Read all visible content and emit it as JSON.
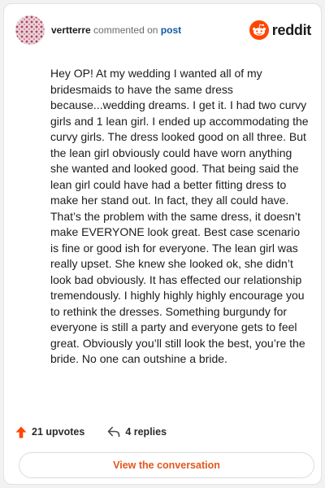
{
  "header": {
    "username": "vertterre",
    "action": "commented on",
    "target": "post",
    "logo_text": "reddit"
  },
  "comment": {
    "body": "Hey OP! At my wedding I wanted all of my bridesmaids to have the same dress because...wedding dreams. I get it. I had two curvy girls and 1 lean girl. I ended up accommodating the curvy girls. The dress looked good on all three. But the lean girl obviously could have worn anything she wanted and looked good. That being said the lean girl could have had a better fitting dress to make her stand out. In fact, they all could have. That’s the problem with the same dress, it doesn’t make EVERYONE look great. Best case scenario is fine or good ish for everyone. The lean girl was really upset. She knew she looked ok, she didn’t look bad obviously. It has effected our relationship tremendously. I highly highly highly encourage you to rethink the dresses. Something burgundy for everyone is still a party and everyone gets to feel great. Obviously you’ll still look the best, you’re the bride. No one can outshine a bride."
  },
  "footer": {
    "upvotes_label": "21 upvotes",
    "replies_label": "4 replies",
    "view_button_label": "View the conversation"
  },
  "icons": {
    "upvote": "upvote-arrow-icon",
    "reply": "reply-arrow-icon",
    "logo": "reddit-snoo-icon"
  },
  "colors": {
    "accent_orange": "#ff4500",
    "button_text": "#e2571d",
    "link_blue": "#0f5aa8"
  }
}
